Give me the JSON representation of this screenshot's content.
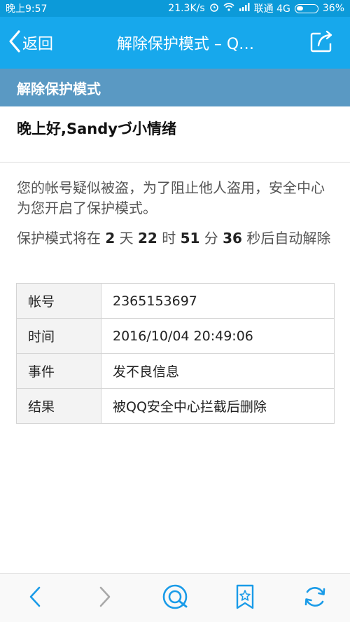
{
  "status_bar": {
    "time": "晚上9:57",
    "speed": "21.3K/s",
    "carrier": "联通 4G",
    "battery": "36%"
  },
  "nav": {
    "back_label": "返回",
    "title": "解除保护模式 – Q…"
  },
  "section": {
    "title": "解除保护模式"
  },
  "greeting": "晚上好,Sandyづ小情绪",
  "notice": "您的帐号疑似被盗，为了阻止他人盗用，安全中心为您开启了保护模式。",
  "countdown": {
    "prefix": "保护模式将在 ",
    "days": "2",
    "days_unit": " 天 ",
    "hours": "22",
    "hours_unit": " 时 ",
    "minutes": "51",
    "minutes_unit": " 分 ",
    "seconds": "36",
    "suffix": " 秒后自动解除"
  },
  "info_table": [
    {
      "key": "帐号",
      "value": "2365153697"
    },
    {
      "key": "时间",
      "value": "2016/10/04  20:49:06"
    },
    {
      "key": "事件",
      "value": "发不良信息"
    },
    {
      "key": "结果",
      "value": "被QQ安全中心拦截后删除"
    }
  ],
  "colors": {
    "status_bar": "#0c9ad9",
    "nav_bar": "#17a8ec",
    "section_head": "#5a99c3",
    "icon_blue": "#1a9be8"
  },
  "bottom_bar": {
    "icons": [
      "back-icon",
      "forward-icon",
      "qq-browser-icon",
      "bookmark-icon",
      "refresh-icon"
    ]
  }
}
